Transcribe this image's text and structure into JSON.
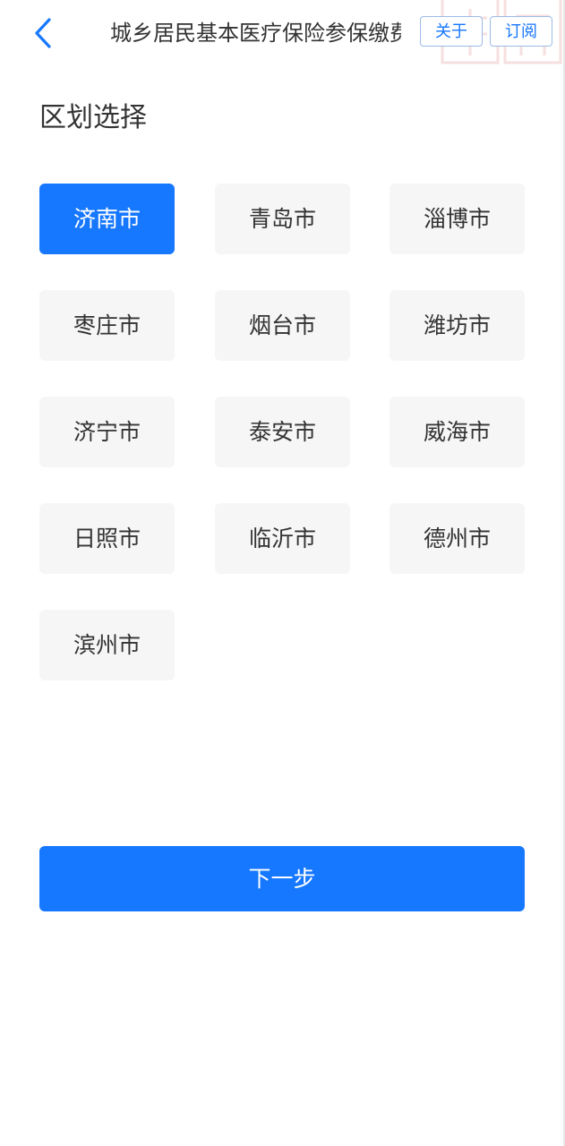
{
  "header": {
    "title": "城乡居民基本医疗保险参保缴费",
    "about_label": "关于",
    "subscribe_label": "订阅",
    "back_icon": "chevron-left-icon"
  },
  "section": {
    "title": "区划选择"
  },
  "regions": [
    {
      "label": "济南市",
      "selected": true
    },
    {
      "label": "青岛市",
      "selected": false
    },
    {
      "label": "淄博市",
      "selected": false
    },
    {
      "label": "枣庄市",
      "selected": false
    },
    {
      "label": "烟台市",
      "selected": false
    },
    {
      "label": "潍坊市",
      "selected": false
    },
    {
      "label": "济宁市",
      "selected": false
    },
    {
      "label": "泰安市",
      "selected": false
    },
    {
      "label": "威海市",
      "selected": false
    },
    {
      "label": "日照市",
      "selected": false
    },
    {
      "label": "临沂市",
      "selected": false
    },
    {
      "label": "德州市",
      "selected": false
    },
    {
      "label": "滨州市",
      "selected": false
    }
  ],
  "footer": {
    "next_label": "下一步"
  },
  "colors": {
    "accent": "#1677ff",
    "tile_bg": "#f6f6f6",
    "text": "#333333"
  }
}
